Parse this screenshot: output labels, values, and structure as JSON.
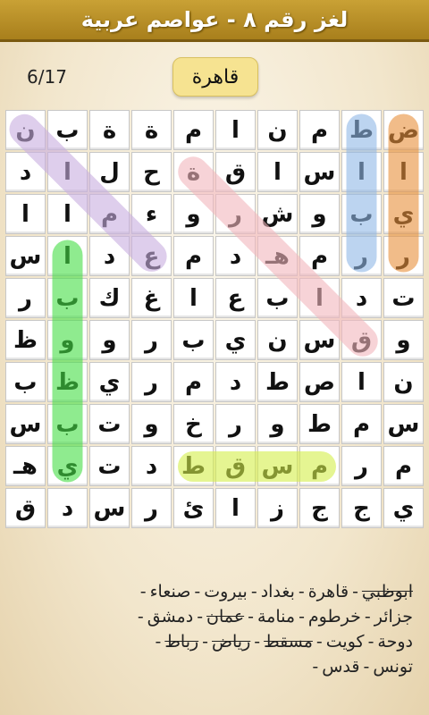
{
  "title": "لغز رقم ٨ - عواصم عربية",
  "progress": "6/17",
  "current_word": "قاهرة",
  "grid": [
    [
      "ض",
      "ط",
      "م",
      "ن",
      "ا",
      "م",
      "ة",
      "ة",
      "ب",
      "ن"
    ],
    [
      "ا",
      "ا",
      "س",
      "ا",
      "ق",
      "ة",
      "ح",
      "ل",
      "ا",
      "د"
    ],
    [
      "ي",
      "ب",
      "و",
      "ش",
      "ر",
      "و",
      "ء",
      "م",
      "ا",
      "ا"
    ],
    [
      "ر",
      "ر",
      "م",
      "هـ",
      "د",
      "م",
      "ع",
      "د",
      "ا",
      "س"
    ],
    [
      "ت",
      "د",
      "ا",
      "ب",
      "ع",
      "ا",
      "غ",
      "ك",
      "ب",
      "ر"
    ],
    [
      "و",
      "ق",
      "س",
      "ن",
      "ي",
      "ب",
      "ر",
      "و",
      "و",
      "ظ"
    ],
    [
      "ن",
      "ا",
      "ص",
      "ط",
      "د",
      "م",
      "ر",
      "ي",
      "ظ",
      "ب"
    ],
    [
      "س",
      "م",
      "ط",
      "و",
      "ر",
      "خ",
      "و",
      "ت",
      "ب",
      "س"
    ],
    [
      "م",
      "ر",
      "م",
      "س",
      "ق",
      "ط",
      "د",
      "ت",
      "ي",
      "هـ"
    ],
    [
      "ي",
      "ج",
      "ج",
      "ز",
      "ا",
      "ئ",
      "ر",
      "س",
      "د",
      "ق"
    ]
  ],
  "highlights": [
    {
      "color": "#e8903a",
      "r1": 0,
      "c1": 0,
      "r2": 3,
      "c2": 0
    },
    {
      "color": "#8fb8e6",
      "r1": 0,
      "c1": 1,
      "r2": 3,
      "c2": 1
    },
    {
      "color": "#f2b6bd",
      "r1": 1,
      "c1": 5,
      "r2": 5,
      "c2": 1
    },
    {
      "color": "#c8aee0",
      "r1": 0,
      "c1": 9,
      "r2": 3,
      "c2": 6
    },
    {
      "color": "#44dd44",
      "r1": 3,
      "c1": 8,
      "r2": 8,
      "c2": 8
    },
    {
      "color": "#d4ef4a",
      "r1": 8,
      "c1": 2,
      "r2": 8,
      "c2": 5
    }
  ],
  "word_list": [
    [
      {
        "t": "ابوظبي",
        "done": true
      },
      {
        "t": "قاهرة",
        "done": false
      },
      {
        "t": "بغداد",
        "done": false
      },
      {
        "t": "بيروت",
        "done": false
      },
      {
        "t": "صنعاء",
        "done": false
      }
    ],
    [
      {
        "t": "جزائر",
        "done": false
      },
      {
        "t": "خرطوم",
        "done": false
      },
      {
        "t": "منامة",
        "done": false
      },
      {
        "t": "عمان",
        "done": true
      },
      {
        "t": "دمشق",
        "done": false
      }
    ],
    [
      {
        "t": "دوحة",
        "done": false
      },
      {
        "t": "كويت",
        "done": false
      },
      {
        "t": "مسقط",
        "done": true
      },
      {
        "t": "رياض",
        "done": true
      },
      {
        "t": "رباط",
        "done": true
      }
    ],
    [
      {
        "t": "تونس",
        "done": false
      },
      {
        "t": "قدس",
        "done": false
      }
    ]
  ]
}
